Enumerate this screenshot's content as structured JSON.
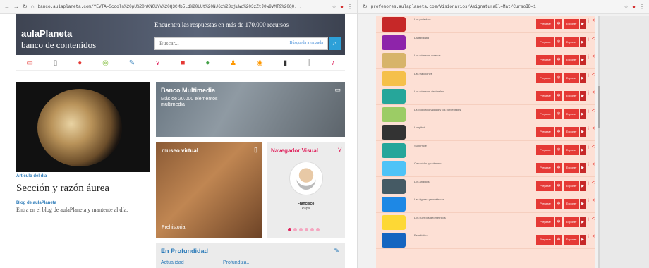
{
  "left_browser": {
    "url": "banco.aulaplaneta.com/?EVTA=Sccoln%20pU%20nXNOUYV%20Q3CMb5Ld%20UUt%20NJ6z%20ojuWq%203zZtJ0w9VMT9%20Q0...",
    "icons": [
      "back-icon",
      "forward-icon",
      "reload-icon",
      "home-icon"
    ]
  },
  "right_browser": {
    "url": "profesores.aulaplaneta.com/Visionarios/AsignaturaEl=Mat/CursoID=1"
  },
  "banco": {
    "logo_main": "aulaPlaneta",
    "logo_sub": "banco de contenidos",
    "tagline": "Encuentra las respuestas en más de 170.000 recursos",
    "search_placeholder": "Buscar...",
    "advanced_link": "Búsqueda avanzada",
    "category_icons": [
      "monitor-icon",
      "document-icon",
      "pin-icon",
      "compass-icon",
      "pushpin-icon",
      "network-icon",
      "briefcase-icon",
      "clock-icon",
      "person-icon",
      "eye-icon",
      "drink-icon",
      "chart-icon",
      "music-icon"
    ],
    "category_colors": [
      "#e53935",
      "#555555",
      "#e53935",
      "#8bc34a",
      "#2a7ab8",
      "#e0245e",
      "#e53935",
      "#43a047",
      "#ff9800",
      "#ff9800",
      "#333333",
      "#999999",
      "#e0245e"
    ]
  },
  "article": {
    "kicker": "Artículo del día",
    "title": "Sección y razón áurea",
    "blog_kicker": "Blog de aulaPlaneta",
    "desc": "Entra en el blog de aulaPlaneta y mantente al día."
  },
  "multimedia": {
    "title": "Banco Multimedia",
    "subtitle": "Más de 20.000 elementos multimedia"
  },
  "museo": {
    "title": "museo virtual",
    "caption": "Prehistoria"
  },
  "navegador": {
    "title": "Navegador Visual",
    "name": "Francisco",
    "role": "Papa"
  },
  "profundidad": {
    "title": "En Profundidad",
    "link_a": "Actualidad",
    "link_b": "Profundiza..."
  },
  "actions": {
    "prepare": "Preparar",
    "expose": "Exponer"
  },
  "topics": [
    {
      "label": "Los poliedros",
      "color": "#c62828"
    },
    {
      "label": "Divisibilidad",
      "color": "#8e24aa"
    },
    {
      "label": "Los números enteros",
      "color": "#d7b46a"
    },
    {
      "label": "Las fracciones",
      "color": "#f5c04a"
    },
    {
      "label": "Los números decimales",
      "color": "#26a69a"
    },
    {
      "label": "La proporcionalidad y los porcentajes",
      "color": "#9ccc65"
    },
    {
      "label": "Longitud",
      "color": "#333333"
    },
    {
      "label": "Superficie",
      "color": "#26a69a"
    },
    {
      "label": "Capacidad y volumen",
      "color": "#4fc3f7"
    },
    {
      "label": "Los ángulos",
      "color": "#455a64"
    },
    {
      "label": "Las figuras geométricas",
      "color": "#1e88e5"
    },
    {
      "label": "Los cuerpos geométricos",
      "color": "#fdd835"
    },
    {
      "label": "Estadística",
      "color": "#1565c0"
    }
  ]
}
